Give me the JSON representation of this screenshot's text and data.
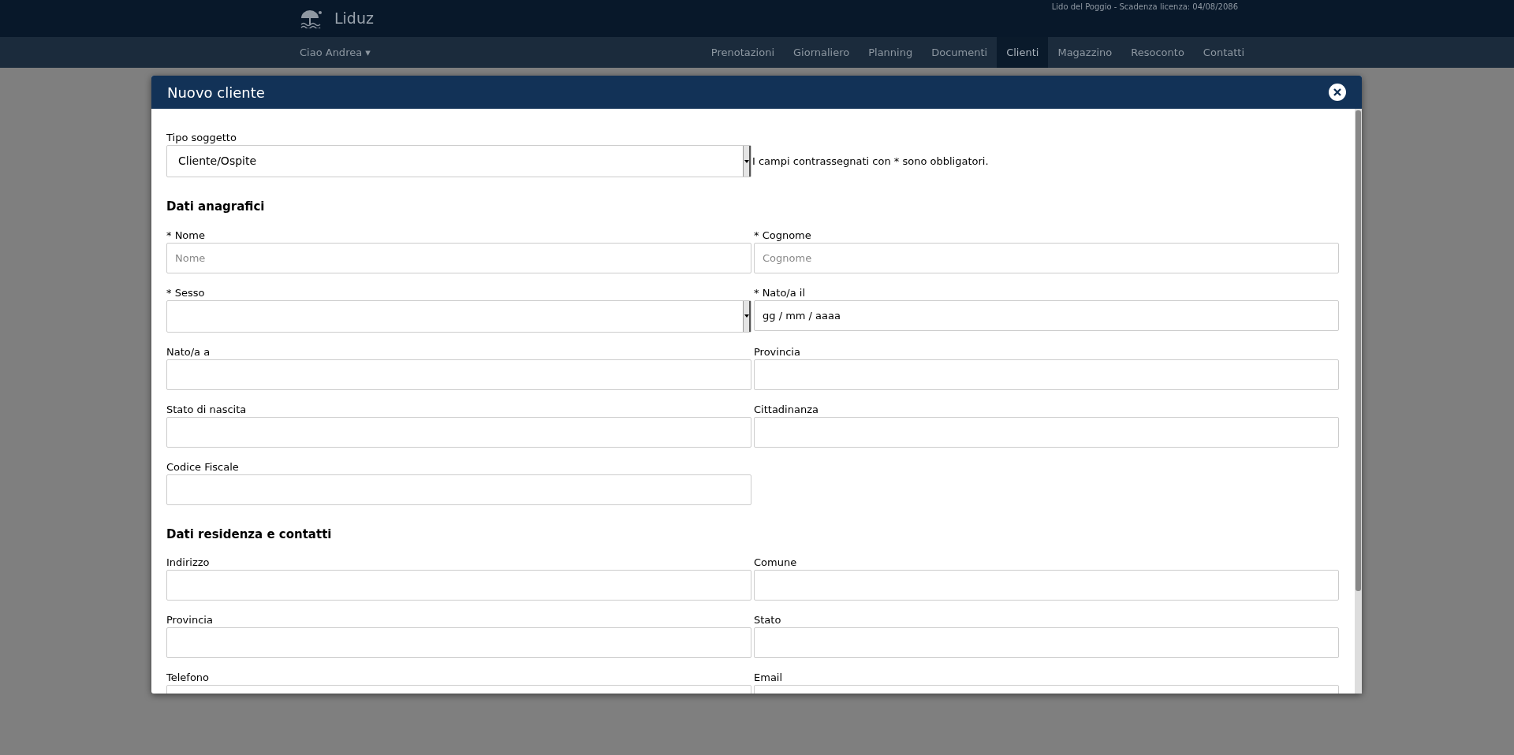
{
  "brand": {
    "name": "Liduz"
  },
  "license": "Lido del Poggio - Scadenza licenza: 04/08/2086",
  "user_menu": "Ciao Andrea ▾",
  "nav": [
    {
      "label": "Prenotazioni",
      "selected": false
    },
    {
      "label": "Giornaliero",
      "selected": false
    },
    {
      "label": "Planning",
      "selected": false
    },
    {
      "label": "Documenti",
      "selected": false
    },
    {
      "label": "Clienti",
      "selected": true
    },
    {
      "label": "Magazzino",
      "selected": false
    },
    {
      "label": "Resoconto",
      "selected": false
    },
    {
      "label": "Contatti",
      "selected": false
    }
  ],
  "modal": {
    "title": "Nuovo cliente",
    "sections": [
      {
        "fields": [
          {
            "kind": "select",
            "label": "Tipo soggetto",
            "value": "Cliente/Ospite"
          },
          {
            "kind": "note",
            "text": "I campi contrassegnati con * sono obbligatori."
          }
        ]
      },
      {
        "title": "Dati anagrafici",
        "fields": [
          {
            "kind": "text",
            "label": "* Nome",
            "placeholder": "Nome"
          },
          {
            "kind": "text",
            "label": "* Cognome",
            "placeholder": "Cognome"
          },
          {
            "kind": "select",
            "label": "* Sesso"
          },
          {
            "kind": "text",
            "label": "* Nato/a il",
            "value": "gg / mm / aaaa"
          },
          {
            "kind": "text",
            "label": "Nato/a a"
          },
          {
            "kind": "text",
            "label": "Provincia"
          },
          {
            "kind": "text",
            "label": "Stato di nascita"
          },
          {
            "kind": "text",
            "label": "Cittadinanza"
          },
          {
            "kind": "text",
            "label": "Codice Fiscale"
          }
        ]
      },
      {
        "title": "Dati residenza e contatti",
        "fields": [
          {
            "kind": "text",
            "label": "Indirizzo"
          },
          {
            "kind": "text",
            "label": "Comune"
          },
          {
            "kind": "text",
            "label": "Provincia"
          },
          {
            "kind": "text",
            "label": "Stato"
          },
          {
            "kind": "text",
            "label": "Telefono"
          },
          {
            "kind": "text",
            "label": "Email"
          }
        ]
      }
    ]
  }
}
